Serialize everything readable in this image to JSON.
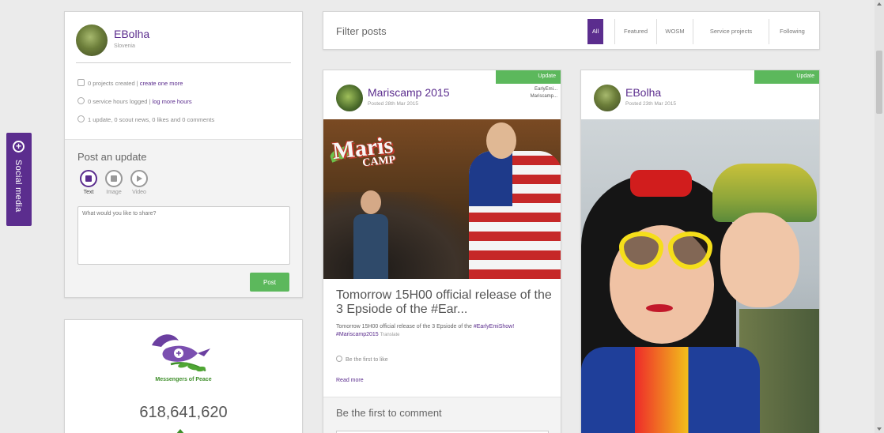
{
  "social_tab": {
    "label": "Social media",
    "icon": "plus-circle-icon"
  },
  "profile": {
    "name": "EBolha",
    "country": "Slovenia",
    "stats": {
      "projects_text": "0 projects created |",
      "projects_link": "create one more",
      "hours_text": "0 service hours logged |",
      "hours_link": "log more hours",
      "activity_text": "1 update, 0 scout news, 0 likes and 0 comments"
    }
  },
  "post_update": {
    "title": "Post an update",
    "types": [
      {
        "label": "Text",
        "icon": "text-icon",
        "active": true
      },
      {
        "label": "Image",
        "icon": "camera-icon",
        "active": false
      },
      {
        "label": "Video",
        "icon": "play-icon",
        "active": false
      }
    ],
    "placeholder": "What would you like to share?",
    "submit_label": "Post"
  },
  "messengers": {
    "label": "Messengers of Peace",
    "count": "618,641,620"
  },
  "filter": {
    "title": "Filter posts",
    "tabs": [
      "All",
      "Featured",
      "WOSM",
      "Service projects",
      "Following"
    ],
    "active_tab": "All"
  },
  "posts": [
    {
      "author": "Mariscamp 2015",
      "date": "Posted 28th Mar 2015",
      "badge": "Update",
      "tags": [
        "EarlyEmi...",
        "Mariscamp..."
      ],
      "image_logo": "Maris",
      "image_logo_sub": "CAMP",
      "title": "Tomorrow 15H00 official release of the 3 Epsiode of the #Ear...",
      "body_text": "Tomorrow 15H00 official release of the 3 Epsiode of the",
      "body_hashtags": "#EarlyEmiShow! #Mariscamp2015",
      "translate": "Translate",
      "likes": "Be the first to like",
      "read_more": "Read more",
      "comment_prompt": "Be the first to comment"
    },
    {
      "author": "EBolha",
      "date": "Posted 23th Mar 2015",
      "badge": "Update"
    }
  ],
  "colors": {
    "brand_purple": "#5b2d8e",
    "update_green": "#5cb85c",
    "mop_green": "#3e8e2a"
  }
}
